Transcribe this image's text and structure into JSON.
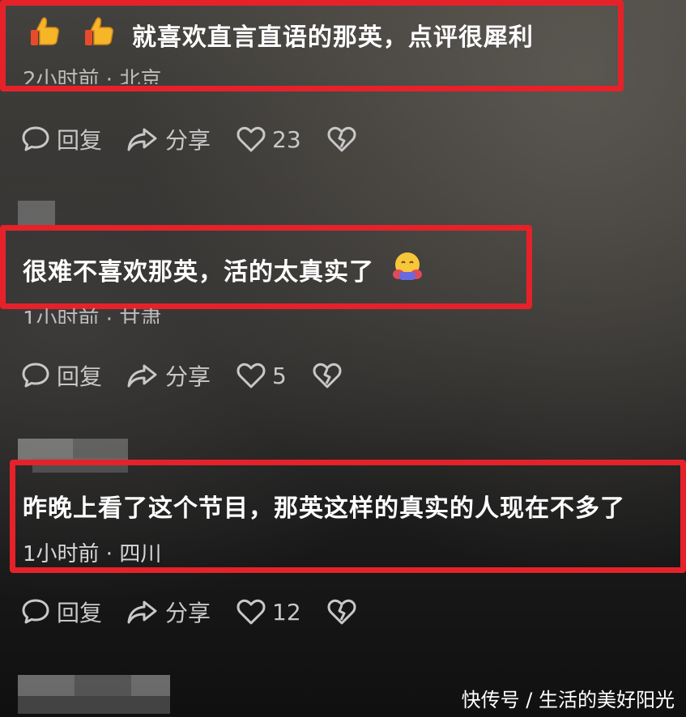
{
  "comments": [
    {
      "text": "就喜欢直言直语的那英，点评很犀利",
      "meta": "2小时前 · 北京",
      "likes": "23",
      "leading_emojis": [
        "thumbs-up",
        "thumbs-up"
      ]
    },
    {
      "text": "很难不喜欢那英，活的太真实了",
      "meta": "1小时前 · 甘肃",
      "likes": "5",
      "trailing_emoji": "hugging-face"
    },
    {
      "text": "昨晚上看了这个节目，那英这样的真实的人现在不多了",
      "meta": "1小时前 · 四川",
      "likes": "12"
    }
  ],
  "actions": {
    "reply_label": "回复",
    "share_label": "分享"
  },
  "watermark": "快传号 / 生活的美好阳光",
  "colors": {
    "highlight": "#e5222a",
    "text": "#ffffff",
    "meta": "#bdbdbd",
    "action": "#c8c8c8"
  },
  "icons": [
    "chat-bubble-icon",
    "share-arrow-icon",
    "heart-icon",
    "broken-heart-icon"
  ]
}
